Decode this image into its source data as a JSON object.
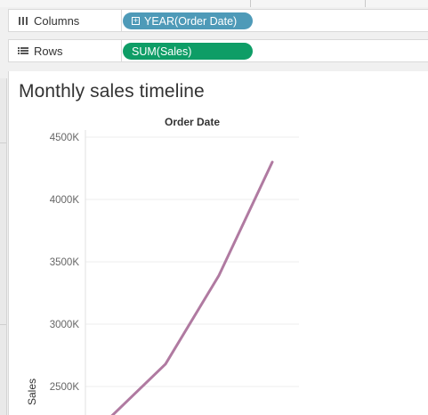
{
  "shelves": {
    "columns": {
      "label": "Columns",
      "pill_label": "YEAR(Order Date)",
      "pill_color": "#4e9ab8"
    },
    "rows": {
      "label": "Rows",
      "pill_label": "SUM(Sales)",
      "pill_color": "#0e9d66"
    }
  },
  "viz": {
    "title": "Monthly sales timeline"
  },
  "chart_data": {
    "type": "line",
    "title": "Monthly sales timeline",
    "column_header": "Order Date",
    "ylabel": "Sales",
    "xlabel": "",
    "ylim": [
      2200,
      4500
    ],
    "y_ticks": [
      2500,
      3000,
      3500,
      4000,
      4500
    ],
    "y_tick_labels": [
      "2500K",
      "3000K",
      "3500K",
      "4000K",
      "4500K"
    ],
    "grid": true,
    "line_color": "#b07aa1",
    "series": [
      {
        "values": [
          2260,
          2680,
          3390,
          4300
        ]
      }
    ]
  }
}
